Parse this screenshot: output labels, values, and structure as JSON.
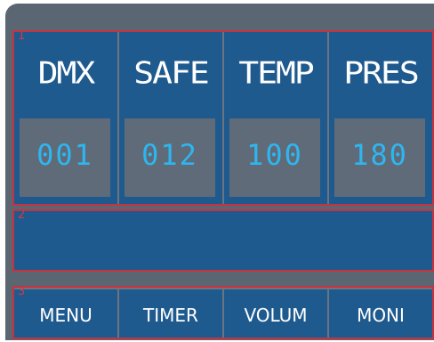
{
  "regions": {
    "r1": "1",
    "r2": "2",
    "r3": "3"
  },
  "readouts": [
    {
      "label": "DMX",
      "value": "001"
    },
    {
      "label": "SAFE",
      "value": "012"
    },
    {
      "label": "TEMP",
      "value": "100"
    },
    {
      "label": "PRES",
      "value": "180"
    }
  ],
  "buttons": [
    "MENU",
    "TIMER",
    "VOLUM",
    "MONI"
  ],
  "colors": {
    "panel": "#5b6673",
    "tile": "#1f5a8f",
    "value_text": "#2eb6f0",
    "region_border": "#c8323f"
  }
}
